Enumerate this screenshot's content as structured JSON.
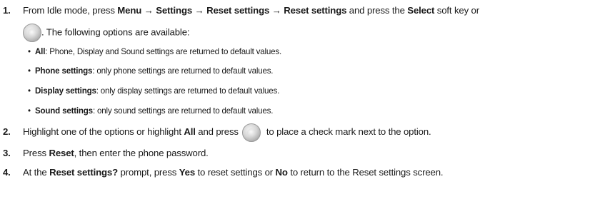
{
  "steps": [
    {
      "num": "1.",
      "parts": [
        {
          "t": "From Idle mode, press ",
          "b": false
        },
        {
          "t": "Menu",
          "b": true
        },
        {
          "t": " → ",
          "b": false
        },
        {
          "t": "Settings",
          "b": true
        },
        {
          "t": " → ",
          "b": false
        },
        {
          "t": "Reset settings",
          "b": true
        },
        {
          "t": " → ",
          "b": false
        },
        {
          "t": "Reset settings",
          "b": true
        },
        {
          "t": " and press the ",
          "b": false
        },
        {
          "t": "Select",
          "b": true
        },
        {
          "t": " soft key or",
          "b": false
        }
      ],
      "cont": ". The following options are available:"
    },
    {
      "num": "2.",
      "pre": [
        {
          "t": "Highlight one of the options or highlight ",
          "b": false
        },
        {
          "t": "All",
          "b": true
        },
        {
          "t": " and press ",
          "b": false
        }
      ],
      "post": " to place a check mark next to the option."
    },
    {
      "num": "3.",
      "parts": [
        {
          "t": "Press ",
          "b": false
        },
        {
          "t": "Reset",
          "b": true
        },
        {
          "t": ", then enter the phone password.",
          "b": false
        }
      ]
    },
    {
      "num": "4.",
      "parts": [
        {
          "t": "At the ",
          "b": false
        },
        {
          "t": "Reset settings?",
          "b": true
        },
        {
          "t": " prompt, press ",
          "b": false
        },
        {
          "t": "Yes",
          "b": true
        },
        {
          "t": " to reset settings or ",
          "b": false
        },
        {
          "t": "No",
          "b": true
        },
        {
          "t": " to return to the Reset settings screen.",
          "b": false
        }
      ]
    }
  ],
  "bullets": [
    {
      "bold": "All",
      "rest": ": Phone, Display and Sound settings are returned to default values."
    },
    {
      "bold": "Phone settings",
      "rest": ": only phone settings are returned to default values."
    },
    {
      "bold": "Display settings",
      "rest": ": only display settings are returned to default values."
    },
    {
      "bold": "Sound settings",
      "rest": ": only sound settings are returned to default values."
    }
  ],
  "icons": {
    "nav_key": "navigation-key-icon",
    "bullet": "•"
  }
}
